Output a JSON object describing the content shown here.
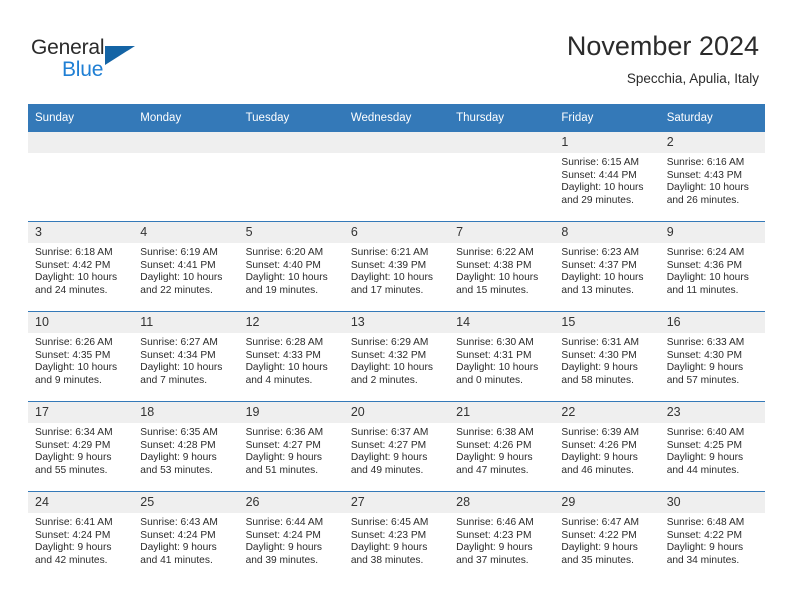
{
  "brand": {
    "word_one": "General",
    "word_two": "Blue",
    "triangle_icon": "triangle-logo-icon",
    "accent_color": "#1f7fd4",
    "logo_color": "#1464a5"
  },
  "header": {
    "title": "November 2024",
    "subtitle": "Specchia, Apulia, Italy"
  },
  "theme": {
    "header_bg": "#3479b8",
    "daynum_bg": "#efefef",
    "text_color": "#2b2b2b"
  },
  "weekday_headers": [
    "Sunday",
    "Monday",
    "Tuesday",
    "Wednesday",
    "Thursday",
    "Friday",
    "Saturday"
  ],
  "labels": {
    "sunrise_prefix": "Sunrise:",
    "sunset_prefix": "Sunset:",
    "daylight_prefix": "Daylight:"
  },
  "weeks": [
    [
      {
        "day": "",
        "sunrise": "",
        "sunset": "",
        "daylight_a": "",
        "daylight_b": "",
        "empty": true
      },
      {
        "day": "",
        "sunrise": "",
        "sunset": "",
        "daylight_a": "",
        "daylight_b": "",
        "empty": true
      },
      {
        "day": "",
        "sunrise": "",
        "sunset": "",
        "daylight_a": "",
        "daylight_b": "",
        "empty": true
      },
      {
        "day": "",
        "sunrise": "",
        "sunset": "",
        "daylight_a": "",
        "daylight_b": "",
        "empty": true
      },
      {
        "day": "",
        "sunrise": "",
        "sunset": "",
        "daylight_a": "",
        "daylight_b": "",
        "empty": true
      },
      {
        "day": "1",
        "sunrise": "Sunrise: 6:15 AM",
        "sunset": "Sunset: 4:44 PM",
        "daylight_a": "Daylight: 10 hours",
        "daylight_b": "and 29 minutes.",
        "empty": false
      },
      {
        "day": "2",
        "sunrise": "Sunrise: 6:16 AM",
        "sunset": "Sunset: 4:43 PM",
        "daylight_a": "Daylight: 10 hours",
        "daylight_b": "and 26 minutes.",
        "empty": false
      }
    ],
    [
      {
        "day": "3",
        "sunrise": "Sunrise: 6:18 AM",
        "sunset": "Sunset: 4:42 PM",
        "daylight_a": "Daylight: 10 hours",
        "daylight_b": "and 24 minutes.",
        "empty": false
      },
      {
        "day": "4",
        "sunrise": "Sunrise: 6:19 AM",
        "sunset": "Sunset: 4:41 PM",
        "daylight_a": "Daylight: 10 hours",
        "daylight_b": "and 22 minutes.",
        "empty": false
      },
      {
        "day": "5",
        "sunrise": "Sunrise: 6:20 AM",
        "sunset": "Sunset: 4:40 PM",
        "daylight_a": "Daylight: 10 hours",
        "daylight_b": "and 19 minutes.",
        "empty": false
      },
      {
        "day": "6",
        "sunrise": "Sunrise: 6:21 AM",
        "sunset": "Sunset: 4:39 PM",
        "daylight_a": "Daylight: 10 hours",
        "daylight_b": "and 17 minutes.",
        "empty": false
      },
      {
        "day": "7",
        "sunrise": "Sunrise: 6:22 AM",
        "sunset": "Sunset: 4:38 PM",
        "daylight_a": "Daylight: 10 hours",
        "daylight_b": "and 15 minutes.",
        "empty": false
      },
      {
        "day": "8",
        "sunrise": "Sunrise: 6:23 AM",
        "sunset": "Sunset: 4:37 PM",
        "daylight_a": "Daylight: 10 hours",
        "daylight_b": "and 13 minutes.",
        "empty": false
      },
      {
        "day": "9",
        "sunrise": "Sunrise: 6:24 AM",
        "sunset": "Sunset: 4:36 PM",
        "daylight_a": "Daylight: 10 hours",
        "daylight_b": "and 11 minutes.",
        "empty": false
      }
    ],
    [
      {
        "day": "10",
        "sunrise": "Sunrise: 6:26 AM",
        "sunset": "Sunset: 4:35 PM",
        "daylight_a": "Daylight: 10 hours",
        "daylight_b": "and 9 minutes.",
        "empty": false
      },
      {
        "day": "11",
        "sunrise": "Sunrise: 6:27 AM",
        "sunset": "Sunset: 4:34 PM",
        "daylight_a": "Daylight: 10 hours",
        "daylight_b": "and 7 minutes.",
        "empty": false
      },
      {
        "day": "12",
        "sunrise": "Sunrise: 6:28 AM",
        "sunset": "Sunset: 4:33 PM",
        "daylight_a": "Daylight: 10 hours",
        "daylight_b": "and 4 minutes.",
        "empty": false
      },
      {
        "day": "13",
        "sunrise": "Sunrise: 6:29 AM",
        "sunset": "Sunset: 4:32 PM",
        "daylight_a": "Daylight: 10 hours",
        "daylight_b": "and 2 minutes.",
        "empty": false
      },
      {
        "day": "14",
        "sunrise": "Sunrise: 6:30 AM",
        "sunset": "Sunset: 4:31 PM",
        "daylight_a": "Daylight: 10 hours",
        "daylight_b": "and 0 minutes.",
        "empty": false
      },
      {
        "day": "15",
        "sunrise": "Sunrise: 6:31 AM",
        "sunset": "Sunset: 4:30 PM",
        "daylight_a": "Daylight: 9 hours",
        "daylight_b": "and 58 minutes.",
        "empty": false
      },
      {
        "day": "16",
        "sunrise": "Sunrise: 6:33 AM",
        "sunset": "Sunset: 4:30 PM",
        "daylight_a": "Daylight: 9 hours",
        "daylight_b": "and 57 minutes.",
        "empty": false
      }
    ],
    [
      {
        "day": "17",
        "sunrise": "Sunrise: 6:34 AM",
        "sunset": "Sunset: 4:29 PM",
        "daylight_a": "Daylight: 9 hours",
        "daylight_b": "and 55 minutes.",
        "empty": false
      },
      {
        "day": "18",
        "sunrise": "Sunrise: 6:35 AM",
        "sunset": "Sunset: 4:28 PM",
        "daylight_a": "Daylight: 9 hours",
        "daylight_b": "and 53 minutes.",
        "empty": false
      },
      {
        "day": "19",
        "sunrise": "Sunrise: 6:36 AM",
        "sunset": "Sunset: 4:27 PM",
        "daylight_a": "Daylight: 9 hours",
        "daylight_b": "and 51 minutes.",
        "empty": false
      },
      {
        "day": "20",
        "sunrise": "Sunrise: 6:37 AM",
        "sunset": "Sunset: 4:27 PM",
        "daylight_a": "Daylight: 9 hours",
        "daylight_b": "and 49 minutes.",
        "empty": false
      },
      {
        "day": "21",
        "sunrise": "Sunrise: 6:38 AM",
        "sunset": "Sunset: 4:26 PM",
        "daylight_a": "Daylight: 9 hours",
        "daylight_b": "and 47 minutes.",
        "empty": false
      },
      {
        "day": "22",
        "sunrise": "Sunrise: 6:39 AM",
        "sunset": "Sunset: 4:26 PM",
        "daylight_a": "Daylight: 9 hours",
        "daylight_b": "and 46 minutes.",
        "empty": false
      },
      {
        "day": "23",
        "sunrise": "Sunrise: 6:40 AM",
        "sunset": "Sunset: 4:25 PM",
        "daylight_a": "Daylight: 9 hours",
        "daylight_b": "and 44 minutes.",
        "empty": false
      }
    ],
    [
      {
        "day": "24",
        "sunrise": "Sunrise: 6:41 AM",
        "sunset": "Sunset: 4:24 PM",
        "daylight_a": "Daylight: 9 hours",
        "daylight_b": "and 42 minutes.",
        "empty": false
      },
      {
        "day": "25",
        "sunrise": "Sunrise: 6:43 AM",
        "sunset": "Sunset: 4:24 PM",
        "daylight_a": "Daylight: 9 hours",
        "daylight_b": "and 41 minutes.",
        "empty": false
      },
      {
        "day": "26",
        "sunrise": "Sunrise: 6:44 AM",
        "sunset": "Sunset: 4:24 PM",
        "daylight_a": "Daylight: 9 hours",
        "daylight_b": "and 39 minutes.",
        "empty": false
      },
      {
        "day": "27",
        "sunrise": "Sunrise: 6:45 AM",
        "sunset": "Sunset: 4:23 PM",
        "daylight_a": "Daylight: 9 hours",
        "daylight_b": "and 38 minutes.",
        "empty": false
      },
      {
        "day": "28",
        "sunrise": "Sunrise: 6:46 AM",
        "sunset": "Sunset: 4:23 PM",
        "daylight_a": "Daylight: 9 hours",
        "daylight_b": "and 37 minutes.",
        "empty": false
      },
      {
        "day": "29",
        "sunrise": "Sunrise: 6:47 AM",
        "sunset": "Sunset: 4:22 PM",
        "daylight_a": "Daylight: 9 hours",
        "daylight_b": "and 35 minutes.",
        "empty": false
      },
      {
        "day": "30",
        "sunrise": "Sunrise: 6:48 AM",
        "sunset": "Sunset: 4:22 PM",
        "daylight_a": "Daylight: 9 hours",
        "daylight_b": "and 34 minutes.",
        "empty": false
      }
    ]
  ]
}
